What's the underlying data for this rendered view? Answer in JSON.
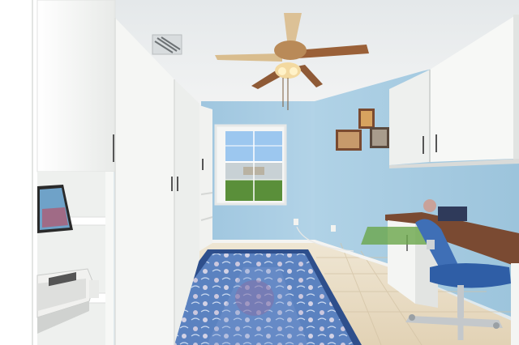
{
  "scene": {
    "description_free": true,
    "colors": {
      "ceiling": "#e9ecec",
      "wall_blue": "#a8cde3",
      "wall_blue_dark": "#8fbcd6",
      "cabinet_white": "#f4f5f3",
      "cabinet_shadow": "#dcdedc",
      "floor_tile": "#e9dcc4",
      "rug_blue": "#4f78b8",
      "rug_border": "#2e4f8c",
      "chair_blue": "#3f6fb6",
      "desk_wood": "#7a4a32",
      "fan_blade": "#a06a42",
      "sky": "#9cc7ef",
      "grass": "#5a8f3a"
    },
    "icons": [
      "ceiling-fan-icon",
      "air-vent-icon",
      "printer-icon",
      "picture-frame-icon",
      "office-chair-icon",
      "wall-outlet-icon"
    ]
  }
}
